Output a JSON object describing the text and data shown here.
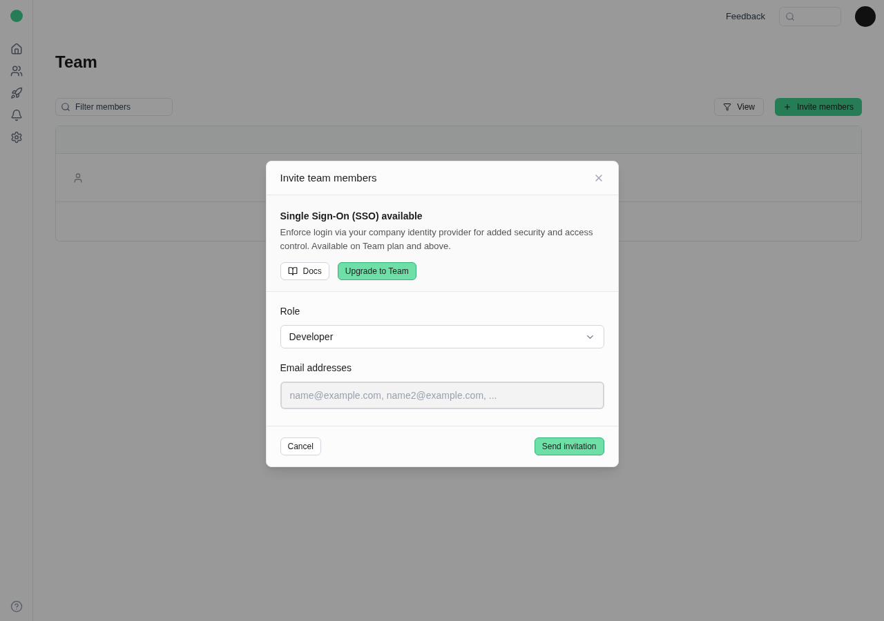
{
  "topbar": {
    "feedback": "Feedback"
  },
  "page": {
    "title": "Team",
    "filter": {
      "placeholder": "Filter members"
    },
    "view_button": "View",
    "invite_button": "Invite members"
  },
  "dialog": {
    "title": "Invite team members",
    "notice": {
      "title": "Single Sign-On (SSO) available",
      "text": "Enforce login via your company identity provider for added security and access control. Available on Team plan and above.",
      "docs_button": "Docs",
      "upgrade_button": "Upgrade to Team"
    },
    "role": {
      "label": "Role",
      "value": "Developer"
    },
    "emails": {
      "label": "Email addresses",
      "placeholder": "name@example.com, name2@example.com, ..."
    },
    "cancel_button": "Cancel",
    "send_button": "Send invitation"
  }
}
